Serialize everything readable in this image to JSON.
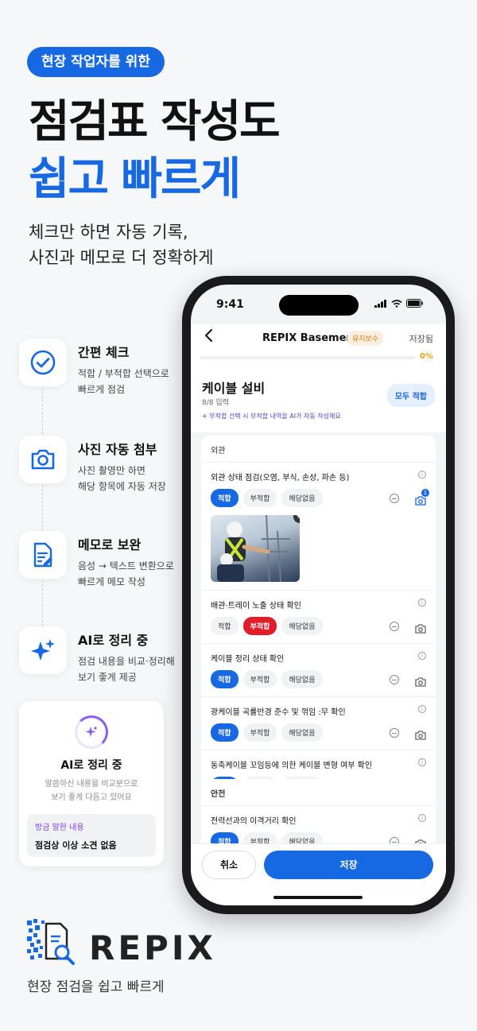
{
  "promo": {
    "pill": "현장 작업자를 위한",
    "headline_line1": "점검표 작성도",
    "headline_line2": "쉽고 빠르게",
    "sub_line1": "체크만 하면 자동 기록,",
    "sub_line2": "사진과 메모로 더 정확하게"
  },
  "features": [
    {
      "title": "간편 체크",
      "desc_line1": "적합 / 부적합 선택으로",
      "desc_line2": "빠르게 점검",
      "icon": "check-circle-icon"
    },
    {
      "title": "사진 자동 첨부",
      "desc_line1": "사진 촬영만 하면",
      "desc_line2": "해당 항목에 자동 저장",
      "icon": "camera-icon"
    },
    {
      "title": "메모로 보완",
      "desc_line1": "음성 → 텍스트 변환으로",
      "desc_line2": "빠르게 메모 작성",
      "icon": "memo-icon"
    },
    {
      "title": "AI로 정리 중",
      "desc_line1": "점검 내용을 비교·정리해",
      "desc_line2": "보기 좋게 제공",
      "icon": "sparkle-icon"
    }
  ],
  "ai_card": {
    "title": "AI로 정리 중",
    "desc_line1": "말씀하신 내용을 비교분으로",
    "desc_line2": "보기 좋게 다듬고 있어요",
    "label": "방금 말한 내용",
    "value": "점검상 이상 소견 없음"
  },
  "brand": {
    "name": "REPIX",
    "tagline": "현장 점검을 쉽고 빠르게"
  },
  "phone": {
    "status_time": "9:41",
    "nav": {
      "title": "REPIX Basement",
      "badge": "유지보수",
      "saved": "저장됨"
    },
    "progress_percent": 0,
    "progress_label": "0%",
    "section": {
      "title": "케이블 설비",
      "count": "8/8 입력",
      "all_ok": "모두 적합",
      "hint": "+ 부적합 선택 시 부적합 내역을 AI가 자동 작성해요"
    },
    "options": [
      "적합",
      "부적합",
      "해당없음"
    ],
    "groups": [
      {
        "name": "외관",
        "items": [
          {
            "label": "외관 상태 점검(오염, 부식, 손상, 파손 등)",
            "selected": 0,
            "photos": 1
          },
          {
            "label": "배관·트레이 노출 상태 확인",
            "selected": 1,
            "photos": 0
          },
          {
            "label": "케이블 정리 상태 확인",
            "selected": 0,
            "photos": 0
          },
          {
            "label": "광케이블 곡률반경 준수 및 꺾임 :무 확인",
            "selected": 0,
            "photos": 0
          },
          {
            "label": "동축케이블 꼬임등에 의한 케이블 변형 여부 확인",
            "selected": 0,
            "photos": 0
          }
        ]
      },
      {
        "name": "안전",
        "items": [
          {
            "label": "전력선과의 이격거리 확인",
            "selected": 0,
            "photos": 0
          }
        ]
      }
    ],
    "photo_badge": "1",
    "buttons": {
      "cancel": "취소",
      "save": "저장"
    }
  },
  "colors": {
    "accent": "#1668e3",
    "danger": "#e11d2a",
    "ai": "#7c3aed"
  }
}
